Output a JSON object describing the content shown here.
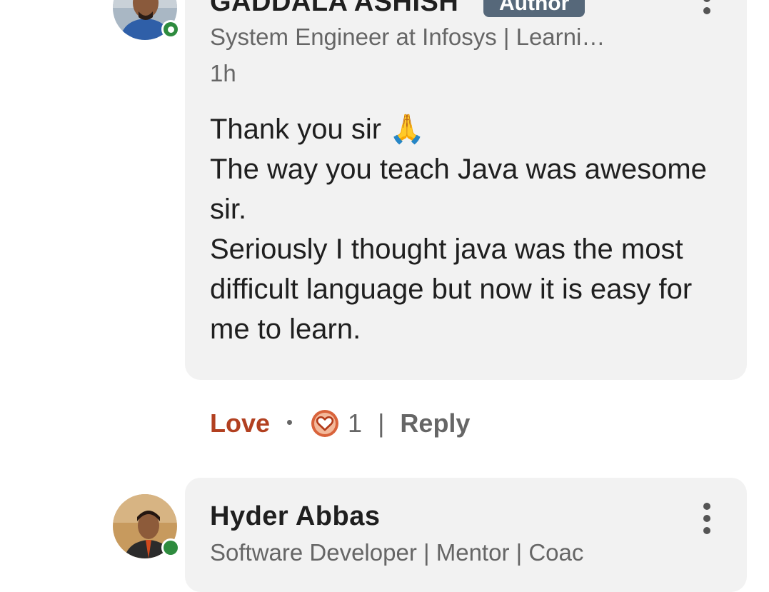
{
  "comment1": {
    "author_name": "GADDALA ASHISH",
    "author_badge": "Author",
    "headline": "System Engineer at Infosys | Learni…",
    "time": "1h",
    "body": "Thank you sir 🙏\nThe way you teach Java was awesome sir.\nSeriously I thought java was the most difficult language but now it is easy for me to learn.",
    "action_love": "Love",
    "reaction_count": "1",
    "separator": "|",
    "action_reply": "Reply"
  },
  "comment2": {
    "author_name": "Hyder Abbas",
    "headline": "Software Developer | Mentor | Coac"
  },
  "colors": {
    "bubble_bg": "#f2f2f2",
    "badge_bg": "#56687a",
    "love_text": "#b24020",
    "love_icon": "#d9633b",
    "online_green": "#2e8b3e",
    "muted_text": "#666666"
  },
  "icons": {
    "more": "more-vertical-icon",
    "reaction": "love-reaction-icon",
    "online": "online-status-icon"
  }
}
